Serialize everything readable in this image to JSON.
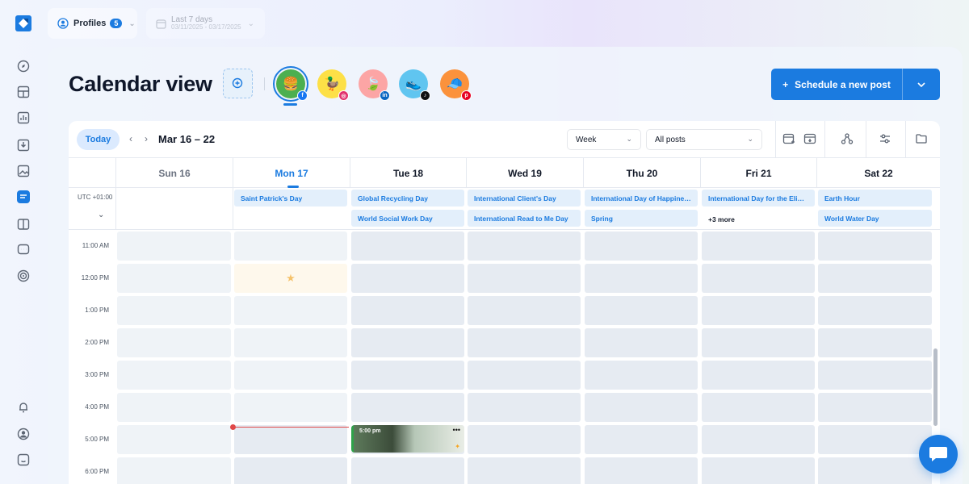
{
  "topbar": {
    "profiles_label": "Profiles",
    "profiles_count": "5",
    "date_range_label": "Last 7 days",
    "date_range_value": "03/11/2025 - 03/17/2025"
  },
  "page": {
    "title": "Calendar view",
    "schedule_button": "Schedule a new post"
  },
  "profiles": [
    {
      "network": "facebook",
      "color": "#4caf50",
      "net_color": "#1877f2",
      "active": true
    },
    {
      "network": "instagram",
      "color": "#fde047",
      "net_color": "#e1306c",
      "active": false
    },
    {
      "network": "linkedin",
      "color": "#fca5a5",
      "net_color": "#0a66c2",
      "active": false
    },
    {
      "network": "tiktok",
      "color": "#60c5f0",
      "net_color": "#111111",
      "active": false
    },
    {
      "network": "pinterest",
      "color": "#fb923c",
      "net_color": "#e60023",
      "active": false
    }
  ],
  "toolbar": {
    "today": "Today",
    "range": "Mar 16 – 22",
    "view_select": "Week",
    "filter_select": "All posts"
  },
  "days": [
    "Sun 16",
    "Mon 17",
    "Tue 18",
    "Wed 19",
    "Thu 20",
    "Fri 21",
    "Sat 22"
  ],
  "timezone": "UTC +01:00",
  "allday_events": {
    "mon": [
      "Saint Patrick's Day"
    ],
    "tue": [
      "Global Recycling Day",
      "World Social Work Day"
    ],
    "wed": [
      "International Client's Day",
      "International Read to Me Day"
    ],
    "thu": [
      "International Day of Happiness",
      "Spring"
    ],
    "fri": [
      "International Day for the Elimination of Racial Discrimination"
    ],
    "fri_more": "+3 more",
    "sat": [
      "Earth Hour",
      "World Water Day"
    ]
  },
  "time_labels": [
    "11:00 AM",
    "12:00 PM",
    "1:00 PM",
    "2:00 PM",
    "3:00 PM",
    "4:00 PM",
    "5:00 PM",
    "6:00 PM"
  ],
  "post": {
    "time": "5:00 pm"
  }
}
